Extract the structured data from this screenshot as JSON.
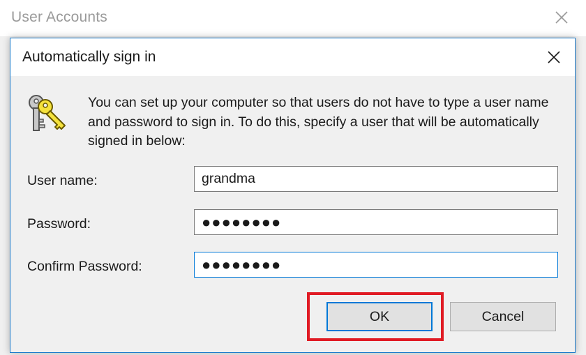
{
  "background_window": {
    "title": "User Accounts"
  },
  "dialog": {
    "title": "Automatically sign in",
    "description": "You can set up your computer so that users do not have to type a user name and password to sign in. To do this, specify a user that will be automatically signed in below:",
    "icon": "keys-icon",
    "fields": {
      "username": {
        "label": "User name:",
        "value": "grandma"
      },
      "password": {
        "label": "Password:",
        "value": "●●●●●●●●"
      },
      "confirm_password": {
        "label": "Confirm Password:",
        "value": "●●●●●●●●"
      }
    },
    "buttons": {
      "ok": "OK",
      "cancel": "Cancel"
    }
  },
  "colors": {
    "dialog_border": "#1979ca",
    "focus_blue": "#0078d7",
    "highlight_red": "#e01b24",
    "button_face": "#e1e1e1"
  }
}
